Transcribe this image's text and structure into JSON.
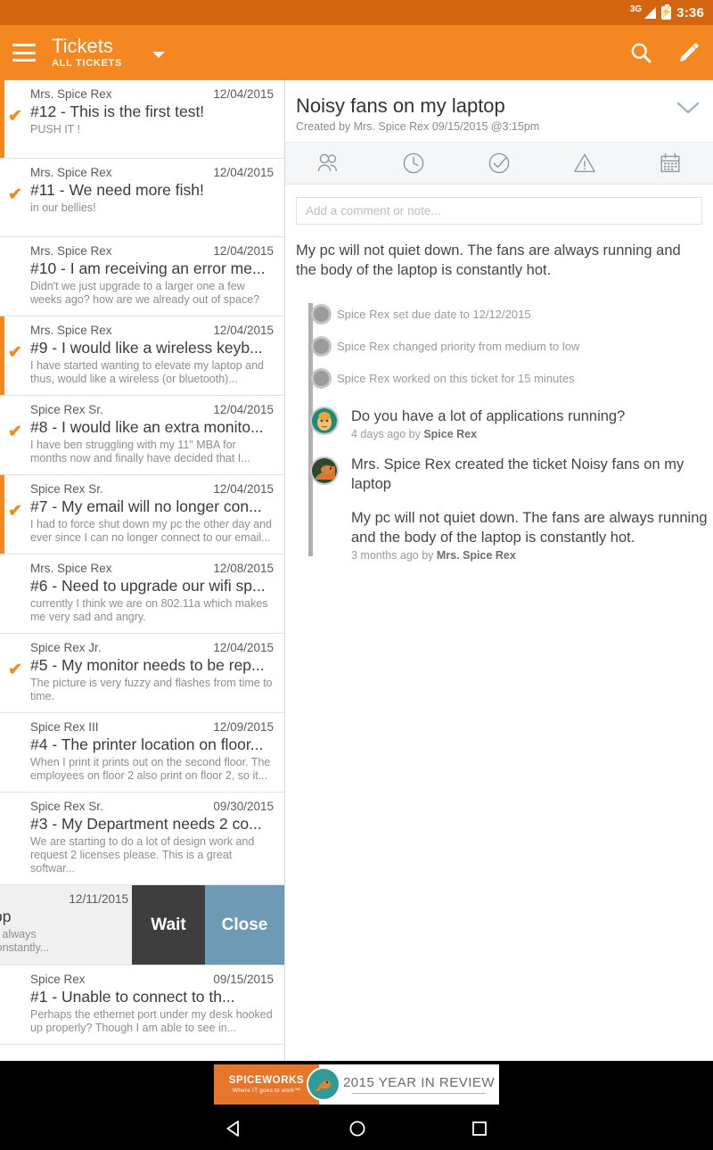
{
  "status_bar": {
    "network": "3G",
    "time": "3:36"
  },
  "app_bar": {
    "title": "Tickets",
    "subtitle": "ALL TICKETS",
    "menu_icon": "hamburger-icon",
    "dropdown_icon": "caret-down-icon",
    "search_icon": "search-icon",
    "compose_icon": "pencil-icon",
    "background": "#f4871f"
  },
  "ticket_list": {
    "items": [
      {
        "from": "Mrs. Spice Rex",
        "date": "12/04/2015",
        "title": "#12 - This is the first test!",
        "snippet": "PUSH IT !",
        "checked": true,
        "bar": true
      },
      {
        "from": "Mrs. Spice Rex",
        "date": "12/04/2015",
        "title": "#11 - We need more fish!",
        "snippet": "in our bellies!",
        "checked": true,
        "bar": false
      },
      {
        "from": "Mrs. Spice Rex",
        "date": "12/04/2015",
        "title": "#10 - I am receiving an error me...",
        "snippet": "Didn't we just upgrade to a larger one a few weeks ago? how are we already out of space?",
        "checked": false,
        "bar": false
      },
      {
        "from": "Mrs. Spice Rex",
        "date": "12/04/2015",
        "title": "#9 - I would like a wireless keyb...",
        "snippet": "I have started wanting to elevate my laptop and thus, would like a wireless (or bluetooth)...",
        "checked": true,
        "bar": true
      },
      {
        "from": "Spice Rex Sr.",
        "date": "12/04/2015",
        "title": "#8 - I would like an extra monito...",
        "snippet": "I have ben struggling with my 11\" MBA for months now and finally have decided that I...",
        "checked": true,
        "bar": false
      },
      {
        "from": "Spice Rex Sr.",
        "date": "12/04/2015",
        "title": "#7 - My email will no longer con...",
        "snippet": "I had to force shut down my pc the other day and ever since I can no longer connect to our email...",
        "checked": true,
        "bar": true
      },
      {
        "from": "Mrs. Spice Rex",
        "date": "12/08/2015",
        "title": "#6 - Need to upgrade our wifi sp...",
        "snippet": "currently I think we are on 802.11a which makes me very sad and angry.",
        "checked": false,
        "bar": false
      },
      {
        "from": "Spice Rex Jr.",
        "date": "12/04/2015",
        "title": "#5 - My monitor needs to be rep...",
        "snippet": "The picture is very fuzzy and flashes from time to time.",
        "checked": true,
        "bar": false
      },
      {
        "from": "Spice Rex III",
        "date": "12/09/2015",
        "title": "#4 - The printer location on floor...",
        "snippet": "When I print it prints out on the second floor. The employees on floor 2 also print on floor 2, so it...",
        "checked": false,
        "bar": false
      },
      {
        "from": "Spice Rex Sr.",
        "date": "09/30/2015",
        "title": "#3 - My Department needs 2 co...",
        "snippet": "We are starting to do a lot of design work and request 2 licenses please. This is a great softwar...",
        "checked": false,
        "bar": false
      }
    ],
    "swiped_item": {
      "date": "12/11/2015",
      "title": "n my laptop",
      "snippet": ". The fans are always\nne laptop is constantly...",
      "action_wait": "Wait",
      "action_close": "Close",
      "wait_color": "#3e3e3e",
      "close_color": "#6d9ab5"
    },
    "last_item": {
      "from": "Spice Rex",
      "date": "09/15/2015",
      "title": "#1 - Unable to connect to th...",
      "snippet": "Perhaps the ethernet port under my desk hooked up properly? Though I am able to see in..."
    },
    "fab": {
      "icon": "plus-icon",
      "color": "#5e91b2"
    }
  },
  "detail": {
    "title": "Noisy fans on my laptop",
    "created": "Created by Mrs. Spice Rex 09/15/2015 @3:15pm",
    "collapse_icon": "chevron-down-icon",
    "actions": [
      {
        "icon": "people-icon",
        "name": "assign"
      },
      {
        "icon": "clock-icon",
        "name": "time"
      },
      {
        "icon": "check-circle-icon",
        "name": "status"
      },
      {
        "icon": "warning-triangle-icon",
        "name": "priority"
      },
      {
        "icon": "calendar-icon",
        "name": "due-date"
      }
    ],
    "comment_placeholder": "Add a comment or note...",
    "description": "My pc will not quiet down. The fans are always running and the body of the laptop is constantly hot.",
    "timeline": [
      "Spice Rex set due date to 12/12/2015",
      "Spice Rex changed priority from medium to low",
      "Spice Rex worked on this ticket for 15 minutes"
    ],
    "comments": [
      {
        "text": "Do you have a lot of applications running?",
        "time": "4 days ago by ",
        "author": "Spice Rex"
      }
    ],
    "created_note": "Mrs. Spice Rex created the ticket Noisy fans on my laptop",
    "original": {
      "text": "My pc will not quiet down. The fans are always running and the body of the laptop is constantly hot.",
      "time": "3 months ago by ",
      "author": "Mrs. Spice Rex"
    }
  },
  "ad": {
    "logo": "SPICEWORKS",
    "tagline": "Where IT goes to work™",
    "headline": "2015 YEAR IN REVIEW",
    "dino_icon": "dinosaur-icon"
  },
  "nav_bar": {
    "back": "back-triangle-icon",
    "home": "home-circle-icon",
    "recents": "recents-square-icon"
  }
}
